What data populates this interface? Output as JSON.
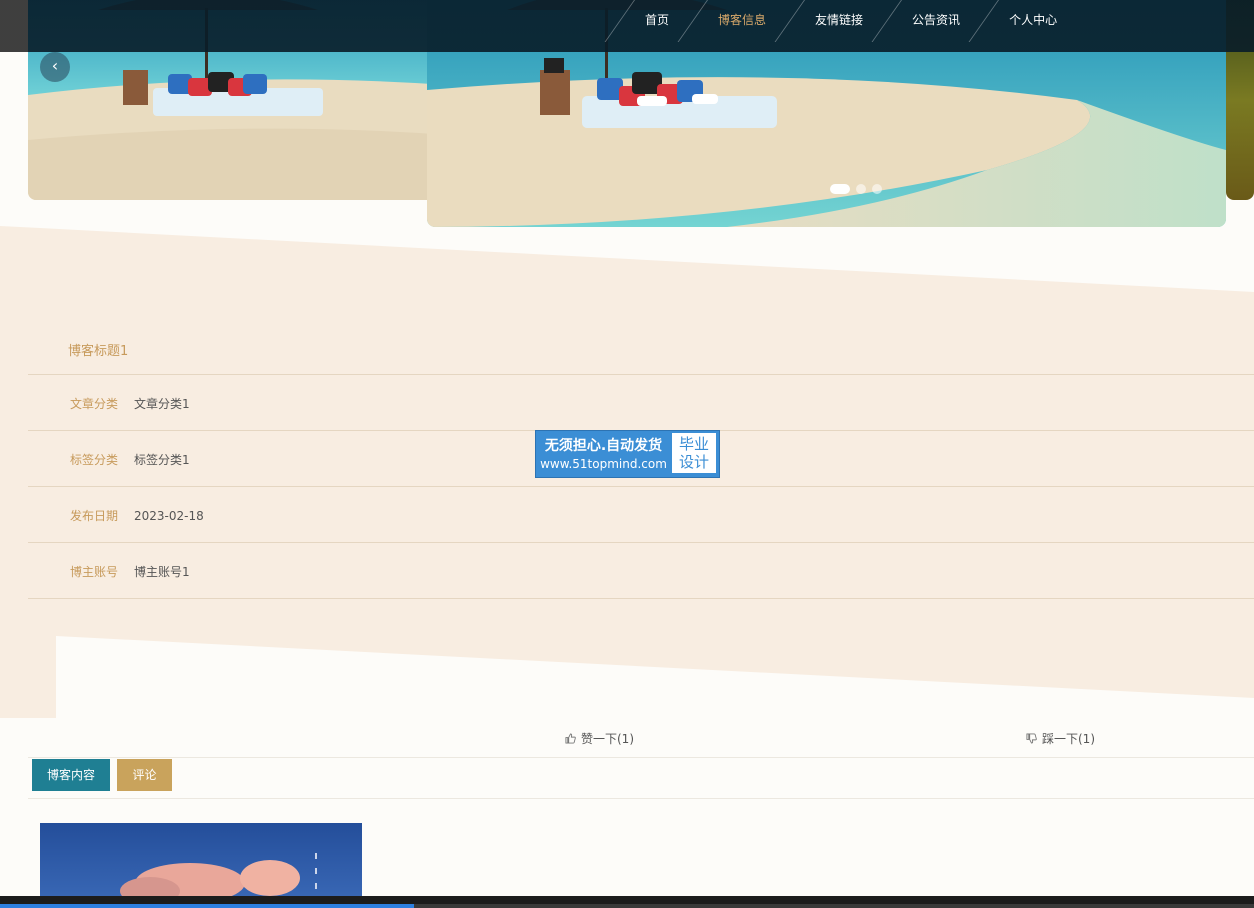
{
  "nav": {
    "items": [
      {
        "label": "首页",
        "active": false
      },
      {
        "label": "博客信息",
        "active": true
      },
      {
        "label": "友情链接",
        "active": false
      },
      {
        "label": "公告资讯",
        "active": false
      },
      {
        "label": "个人中心",
        "active": false
      }
    ]
  },
  "carousel": {
    "prev_icon": "chevron-left-icon",
    "prev_glyph": "‹",
    "slide_count": 3,
    "active_slide": 1
  },
  "blog": {
    "title": "博客标题1",
    "fields": [
      {
        "label": "文章分类",
        "value": "文章分类1"
      },
      {
        "label": "标签分类",
        "value": "标签分类1"
      },
      {
        "label": "发布日期",
        "value": "2023-02-18"
      },
      {
        "label": "博主账号",
        "value": "博主账号1"
      }
    ]
  },
  "watermark": {
    "line1": "无须担心.自动发货",
    "line2": "www.51topmind.com",
    "badge_line1": "毕业",
    "badge_line2": "设计"
  },
  "actions": {
    "like_label": "赞一下(1)",
    "like_icon": "thumbs-up-icon",
    "dislike_label": "踩一下(1)",
    "dislike_icon": "thumbs-down-icon"
  },
  "tabs": [
    {
      "label": "博客内容",
      "active": true
    },
    {
      "label": "评论",
      "active": false
    }
  ],
  "video_progress": {
    "fraction": 0.33
  },
  "colors": {
    "accent_gold": "#c79a5b",
    "tab_teal": "#1f7f93",
    "tab_gold": "#c9a35c",
    "section_bg": "#f8ede1",
    "progress_blue": "#2d7fe0"
  }
}
